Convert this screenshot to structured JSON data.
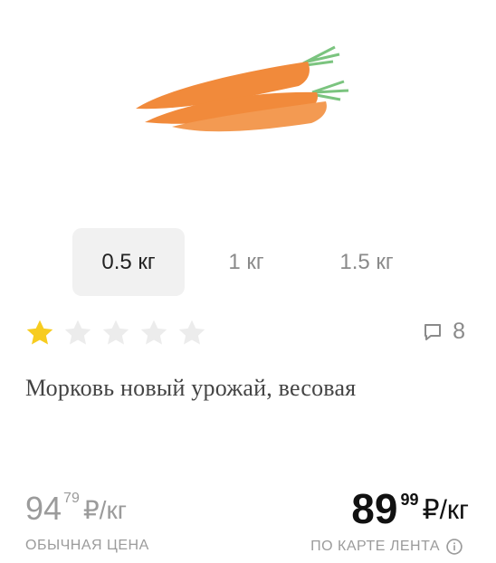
{
  "product": {
    "image_alt": "carrots",
    "title": "Морковь новый урожай, весовая"
  },
  "weights": [
    {
      "label": "0.5 кг",
      "selected": true
    },
    {
      "label": "1 кг",
      "selected": false
    },
    {
      "label": "1.5 кг",
      "selected": false
    }
  ],
  "rating": {
    "stars_filled": 1,
    "stars_total": 5,
    "reviews_count": "8"
  },
  "prices": {
    "regular": {
      "int": "94",
      "dec": "79",
      "unit": "₽/кг",
      "caption": "ОБЫЧНАЯ ЦЕНА"
    },
    "card": {
      "int": "89",
      "dec": "99",
      "unit": "₽/кг",
      "caption": "ПО КАРТЕ ЛЕНТА"
    }
  },
  "colors": {
    "star_filled": "#f7cc1f",
    "star_empty": "#ececec",
    "carrot": "#f18a3b",
    "leaf": "#7bc47f"
  },
  "icons": {
    "comment": "comment-icon",
    "info": "info-icon",
    "star": "star-icon"
  }
}
